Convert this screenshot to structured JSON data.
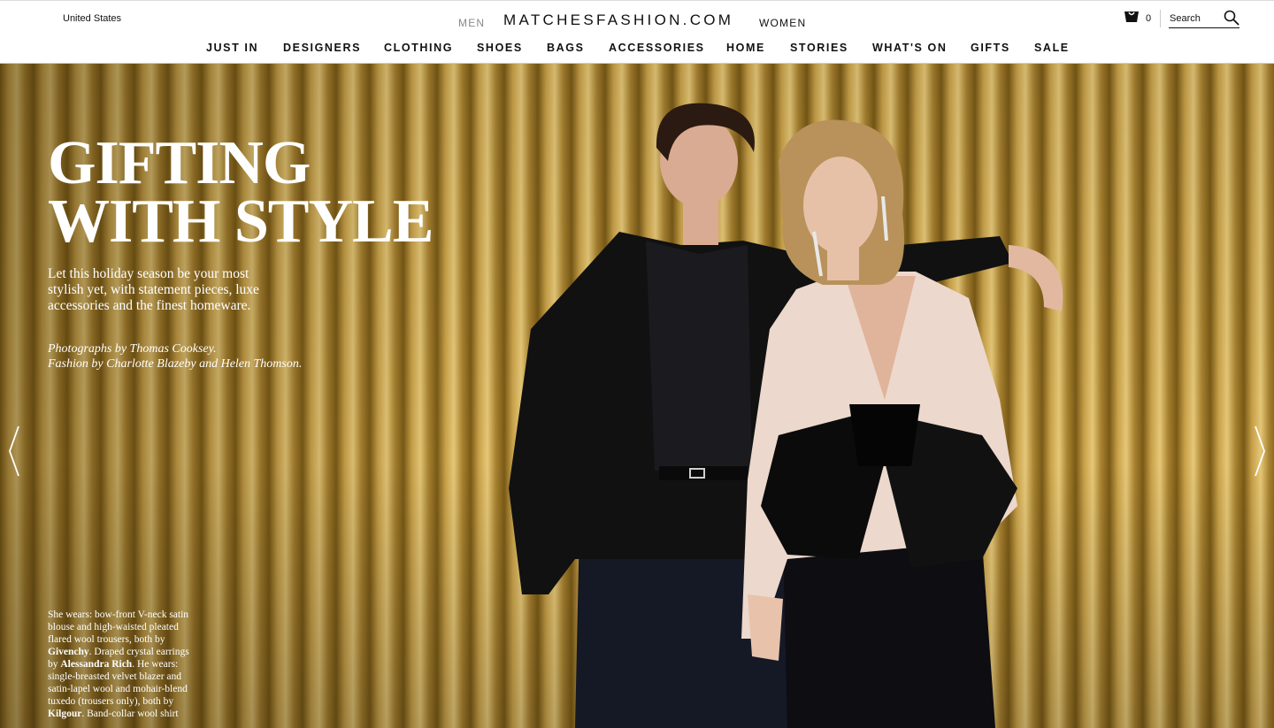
{
  "header": {
    "region": "United States",
    "gender_men": "MEN",
    "logo": "MATCHESFASHION.COM",
    "gender_women": "WOMEN",
    "bag_count": "0",
    "search_placeholder": "Search"
  },
  "nav": {
    "items": [
      "JUST IN",
      "DESIGNERS",
      "CLOTHING",
      "SHOES",
      "BAGS",
      "ACCESSORIES",
      "HOME",
      "STORIES",
      "WHAT'S ON",
      "GIFTS",
      "SALE"
    ]
  },
  "hero": {
    "headline_line1": "GIFTING",
    "headline_line2": "WITH STYLE",
    "intro": "Let this holiday season be your most stylish yet, with statement pieces, luxe accessories and the finest homeware.",
    "credit_photos": "Photographs by Thomas Cooksey.",
    "credit_fashion": "Fashion by Charlotte Blazeby and Helen Thomson.",
    "caption": {
      "part1": "She wears: bow-front V-neck satin blouse and high-waisted pleated flared wool trousers, both by ",
      "brand1": "Givenchy",
      "part2": ". Draped crystal earrings by ",
      "brand2": "Alessandra Rich",
      "part3": ". He wears: single-breasted velvet blazer and satin-lapel wool and mohair-blend tuxedo (trousers only), both by ",
      "brand3": "Kilgour",
      "part4": ". Band-collar wool shirt"
    },
    "colors": {
      "curtain_dark": "#7a5a16",
      "curtain_light": "#e6c878",
      "blazer": "#111111",
      "blouse": "#ecd8cc"
    }
  }
}
